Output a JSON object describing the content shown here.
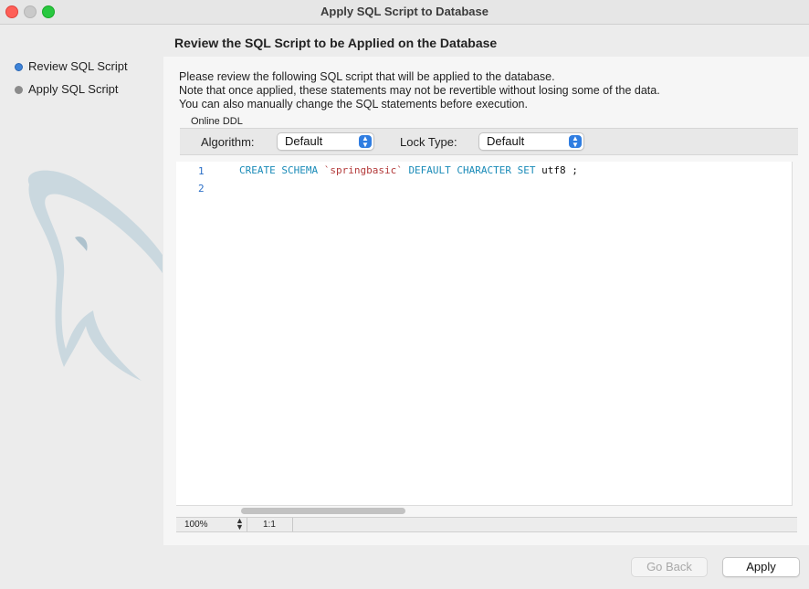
{
  "window": {
    "title": "Apply SQL Script to Database"
  },
  "sidebar": {
    "steps": [
      {
        "label": "Review SQL Script",
        "active": true
      },
      {
        "label": "Apply SQL Script",
        "active": false
      }
    ],
    "logo_icon": "dolphin-watermark-icon"
  },
  "page": {
    "heading": "Review the SQL Script to be Applied on the Database"
  },
  "description": {
    "line1": "Please review the following SQL script that will be applied to the database.",
    "line2": "Note that once applied, these statements may not be revertible without losing some of the data.",
    "line3": "You can also manually change the SQL statements before execution."
  },
  "online_ddl": {
    "group_label": "Online DDL",
    "algorithm_label": "Algorithm:",
    "algorithm_value": "Default",
    "lock_type_label": "Lock Type:",
    "lock_type_value": "Default"
  },
  "editor": {
    "line_numbers": [
      "1",
      "2"
    ],
    "code_line1": {
      "kw1": "CREATE SCHEMA",
      "schema": "`springbasic`",
      "kw2": "DEFAULT CHARACTER SET",
      "rest": "utf8 ;"
    }
  },
  "statusbar": {
    "zoom": "100%",
    "position": "1:1"
  },
  "buttons": {
    "back_label": "Go Back",
    "apply_label": "Apply"
  },
  "colors": {
    "keyword": "#1a8bb8",
    "string": "#b33a3a",
    "accent": "#2f7de1",
    "close": "#fe5f57",
    "maximize": "#29c840"
  }
}
